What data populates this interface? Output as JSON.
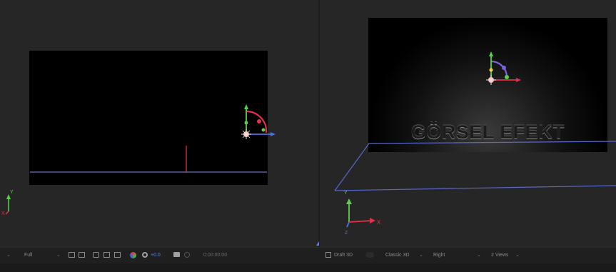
{
  "right_view": {
    "title_text": "GÖRSEL EFEKT"
  },
  "toolbar": {
    "resolution": "Full",
    "exposure": "+0.0",
    "timecode": "0:00:00:00",
    "draft3d": "Draft 3D",
    "renderer": "Classic 3D",
    "view": "Right",
    "layout": "2 Views"
  },
  "axis_labels": {
    "y": "Y",
    "x": "X",
    "z": "Z"
  },
  "colors": {
    "x_axis": "#e0324a",
    "y_axis": "#5cd04a",
    "z_axis": "#4a72e8",
    "grid": "#5a68c8",
    "bg": "#262626"
  },
  "icons": [
    "chevron-down-icon",
    "region-icon",
    "transparency-grid-icon",
    "mask-icon",
    "safe-margins-icon",
    "channel-icon",
    "color-wheel-icon",
    "exposure-reset-icon",
    "camera-icon",
    "show-snapshot-icon",
    "draft3d-icon"
  ]
}
